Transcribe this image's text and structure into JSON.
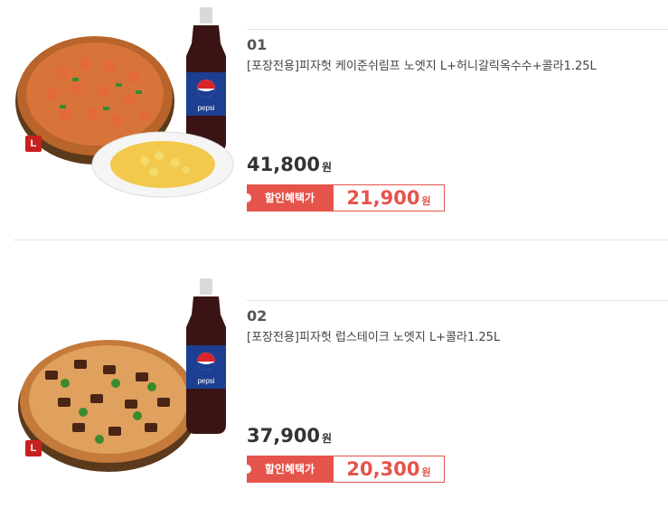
{
  "products": [
    {
      "number": "01",
      "title": "[포장전용]피자헛 케이준쉬림프 노엣지 L+허니갈릭옥수수+콜라1.25L",
      "price": "41,800",
      "currency": "원",
      "discount_label": "할인혜택가",
      "discount_price": "21,900",
      "size_badge": "L",
      "bottle_brand": "pepsi"
    },
    {
      "number": "02",
      "title": "[포장전용]피자헛 럽스테이크 노엣지 L+콜라1.25L",
      "price": "37,900",
      "currency": "원",
      "discount_label": "할인혜택가",
      "discount_price": "20,300",
      "size_badge": "L",
      "bottle_brand": "pepsi"
    }
  ],
  "colors": {
    "accent": "#e5544b",
    "badge": "#c8201f",
    "divider": "#e2e2e2"
  }
}
